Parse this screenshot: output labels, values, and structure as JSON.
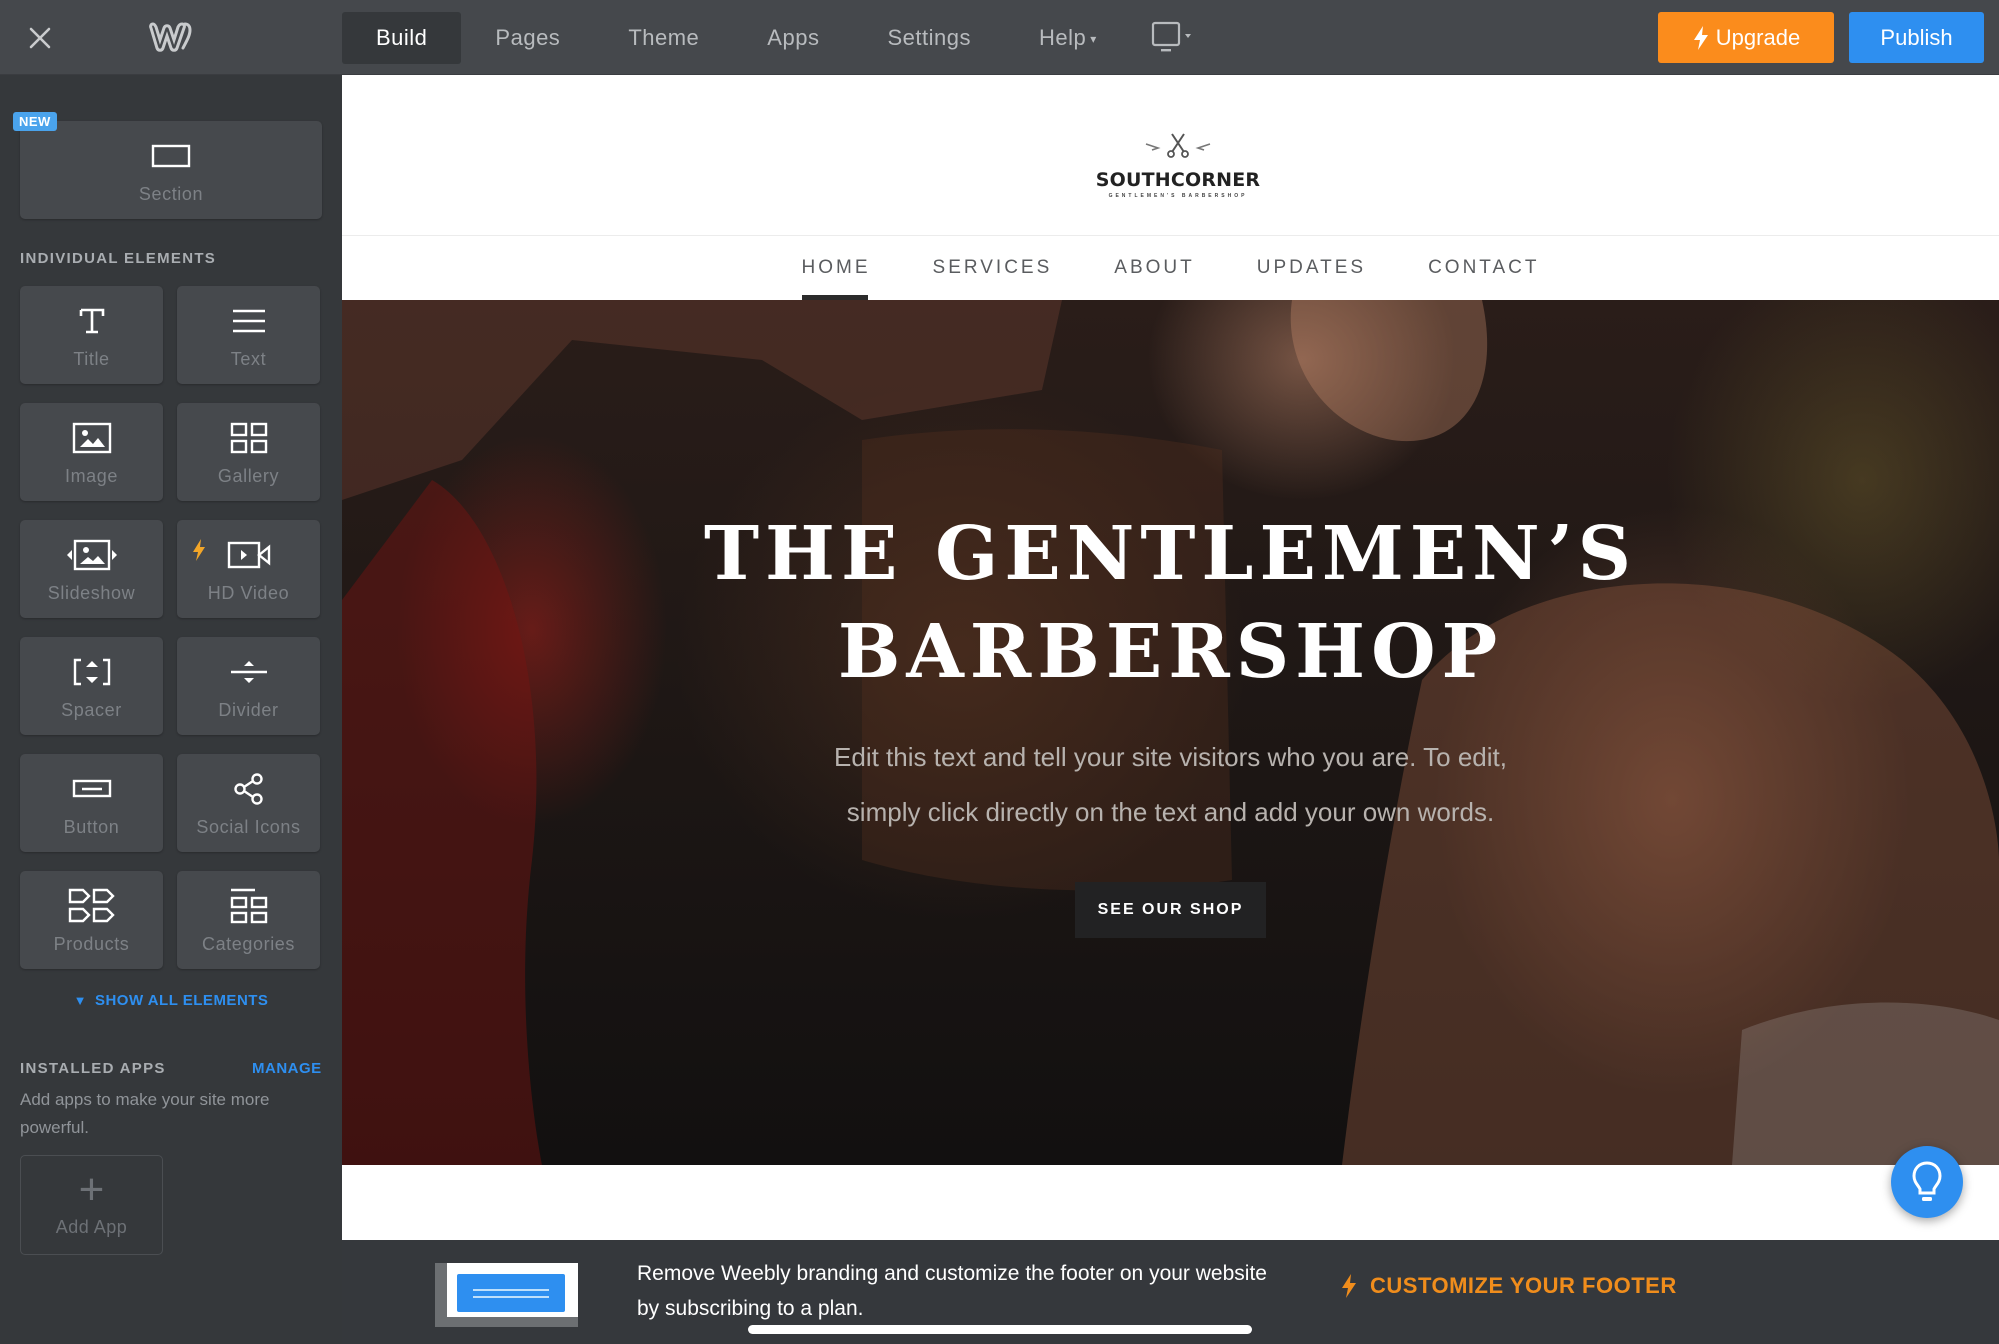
{
  "topbar": {
    "close_icon": "close-icon",
    "logo_icon": "weebly-logo-icon",
    "tabs": [
      {
        "label": "Build",
        "active": true
      },
      {
        "label": "Pages"
      },
      {
        "label": "Theme"
      },
      {
        "label": "Apps"
      },
      {
        "label": "Settings"
      },
      {
        "label": "Help",
        "has_dropdown": true
      }
    ],
    "device_icon": "tablet-device-icon",
    "upgrade_label": "Upgrade",
    "publish_label": "Publish",
    "colors": {
      "upgrade": "#fb8c1c",
      "publish": "#2e8ff0"
    }
  },
  "sidebar": {
    "section_tile": {
      "badge": "NEW",
      "label": "Section",
      "icon": "section-icon"
    },
    "individual_heading": "INDIVIDUAL ELEMENTS",
    "elements": [
      {
        "label": "Title",
        "icon": "title-icon"
      },
      {
        "label": "Text",
        "icon": "text-icon"
      },
      {
        "label": "Image",
        "icon": "image-icon"
      },
      {
        "label": "Gallery",
        "icon": "gallery-icon"
      },
      {
        "label": "Slideshow",
        "icon": "slideshow-icon"
      },
      {
        "label": "HD Video",
        "icon": "video-icon",
        "premium": true
      },
      {
        "label": "Spacer",
        "icon": "spacer-icon"
      },
      {
        "label": "Divider",
        "icon": "divider-icon"
      },
      {
        "label": "Button",
        "icon": "button-icon"
      },
      {
        "label": "Social Icons",
        "icon": "share-icon"
      },
      {
        "label": "Products",
        "icon": "products-icon"
      },
      {
        "label": "Categories",
        "icon": "categories-icon"
      }
    ],
    "show_all_label": "SHOW ALL ELEMENTS",
    "installed_apps_heading": "INSTALLED APPS",
    "manage_label": "MANAGE",
    "apps_description": "Add apps to make your site more powerful.",
    "add_app_label": "Add App"
  },
  "site": {
    "logo": {
      "brand": "SOUTHCORNER",
      "tagline": "GENTLEMEN'S BARBERSHOP"
    },
    "nav": [
      {
        "label": "HOME",
        "active": true
      },
      {
        "label": "SERVICES"
      },
      {
        "label": "ABOUT"
      },
      {
        "label": "UPDATES"
      },
      {
        "label": "CONTACT"
      }
    ],
    "hero": {
      "title_line1": "THE GENTLEMENʼS",
      "title_line2": "BARBERSHOP",
      "text_line1": "Edit this text and tell your site visitors who you are. To edit,",
      "text_line2": "simply click directly on the text and add your own words.",
      "button_label": "SEE OUR SHOP"
    }
  },
  "help_button": {
    "icon": "lightbulb-icon",
    "color": "#2e8ff0"
  },
  "footer_banner": {
    "text": "Remove Weebly branding and customize the footer on your website by subscribing to a plan.",
    "cta_label": "CUSTOMIZE YOUR FOOTER",
    "cta_color": "#f08d1c"
  }
}
